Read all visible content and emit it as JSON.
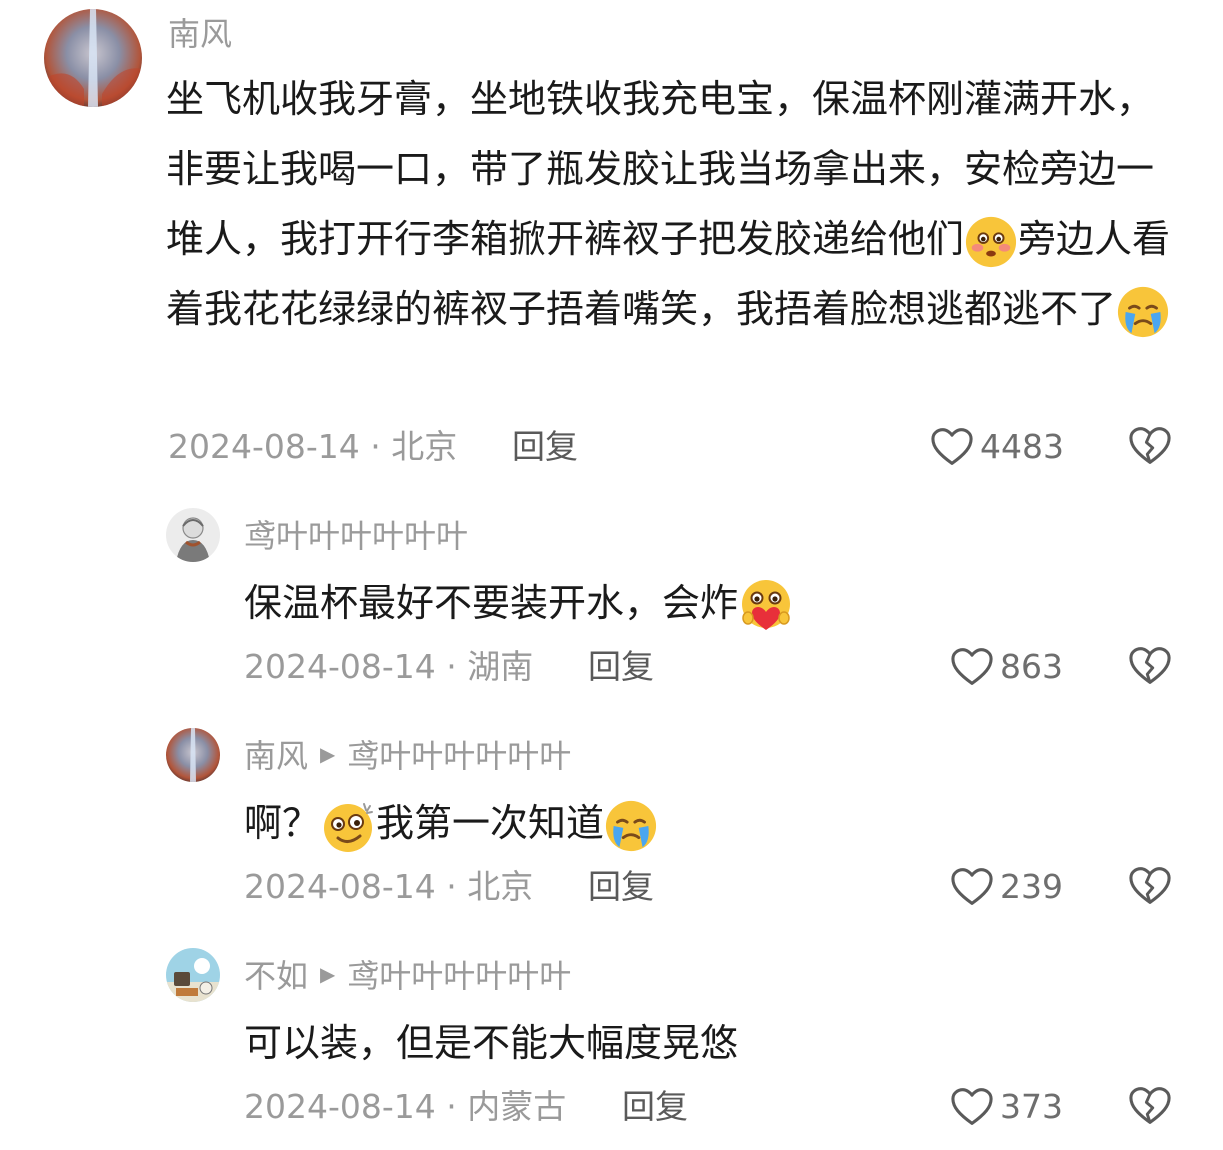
{
  "comments": [
    {
      "user": "南风",
      "text_parts": [
        "坐飞机收我牙膏，坐地铁收我充电宝，保温杯刚灌满开水，非要让我喝一口，带了瓶发胶让我当场拿出来，安检旁边一堆人，我打开行李箱掀开裤衩子把发胶递给他们",
        "旁边人看着我花花绿绿的裤衩子捂着嘴笑，我捂着脸想逃都逃不了"
      ],
      "emojis": [
        "flushed-face-emoji",
        "crying-face-emoji"
      ],
      "date_location": "2024-08-14 · 北京",
      "reply_label": "回复",
      "likes": "4483"
    },
    {
      "user": "鸢叶叶叶叶叶叶",
      "text": "保温杯最好不要装开水，会炸",
      "emojis": [
        "heart-holding-face-emoji"
      ],
      "date_location": "2024-08-14 · 湖南",
      "reply_label": "回复",
      "likes": "863"
    },
    {
      "user": "南风",
      "reply_to": "鸢叶叶叶叶叶叶",
      "text_parts": [
        "啊？",
        "我第一次知道"
      ],
      "emojis": [
        "silly-face-emoji",
        "crying-face-emoji"
      ],
      "date_location": "2024-08-14 · 北京",
      "reply_label": "回复",
      "likes": "239"
    },
    {
      "user": "不如",
      "reply_to": "鸢叶叶叶叶叶叶",
      "text": "可以装，但是不能大幅度晃悠",
      "date_location": "2024-08-14 · 内蒙古",
      "reply_label": "回复",
      "likes": "373"
    }
  ],
  "icons": {
    "like": "heart-outline-icon",
    "dislike": "broken-heart-icon",
    "reply_arrow": "triangle-right-icon"
  }
}
